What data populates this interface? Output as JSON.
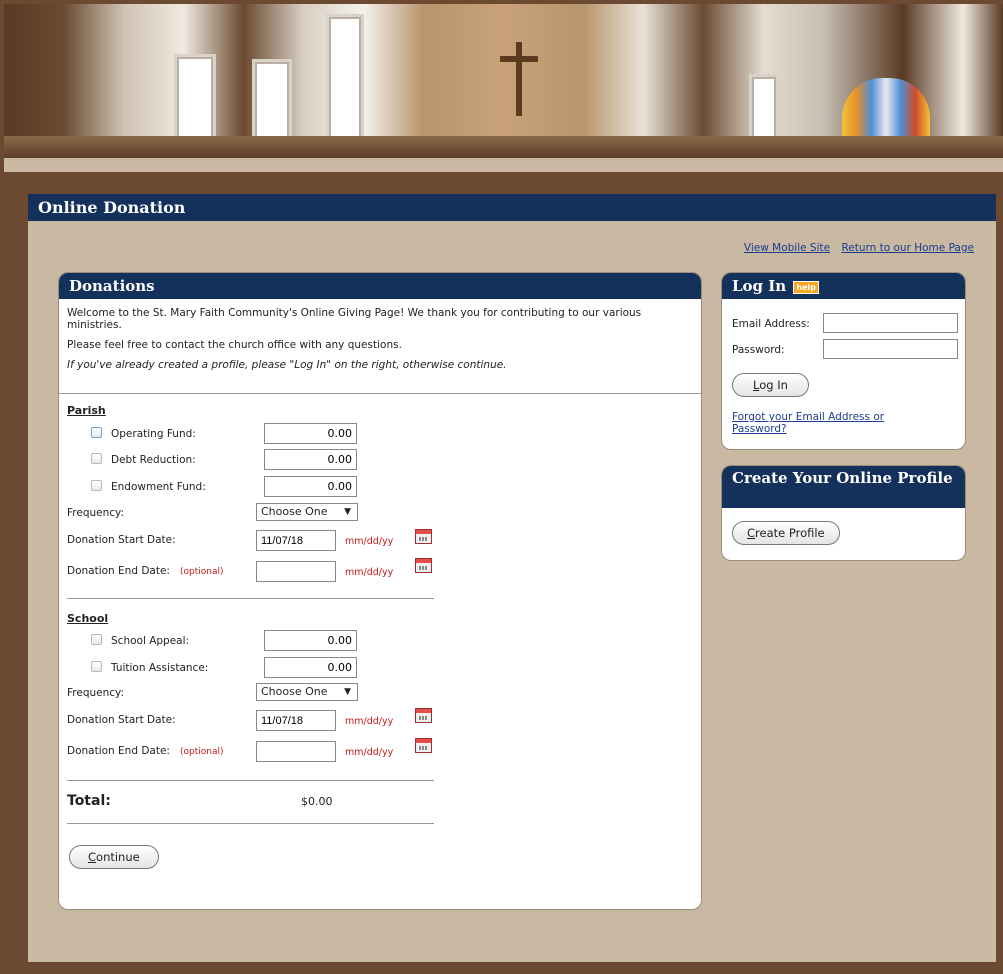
{
  "banner": {
    "description_icon": "church-interior-banner"
  },
  "page": {
    "title": "Online Donation"
  },
  "top_links": {
    "mobile": "View Mobile Site",
    "home": "Return to our Home Page"
  },
  "donations": {
    "header": "Donations",
    "intro": "Welcome to the St. Mary Faith Community's Online Giving Page! We thank you for contributing to our various ministries.",
    "contact": "Please feel free to contact the church office with any questions.",
    "login_hint": "If you've already created a profile, please \"Log In\" on the right, otherwise continue.",
    "parish": {
      "title": "Parish",
      "funds": [
        {
          "label": "Operating Fund:",
          "amount": "0.00"
        },
        {
          "label": "Debt Reduction:",
          "amount": "0.00"
        },
        {
          "label": "Endowment Fund:",
          "amount": "0.00"
        }
      ],
      "frequency_label": "Frequency:",
      "frequency_value": "Choose One",
      "start_label": "Donation Start Date:",
      "start_value": "11/07/18",
      "end_label": "Donation End Date:",
      "end_value": "",
      "optional": "(optional)",
      "date_format": "mm/dd/yy"
    },
    "school": {
      "title": "School",
      "funds": [
        {
          "label": "School Appeal:",
          "amount": "0.00"
        },
        {
          "label": "Tuition Assistance:",
          "amount": "0.00"
        }
      ],
      "frequency_label": "Frequency:",
      "frequency_value": "Choose One",
      "start_label": "Donation Start Date:",
      "start_value": "11/07/18",
      "end_label": "Donation End Date:",
      "end_value": "",
      "optional": "(optional)",
      "date_format": "mm/dd/yy"
    },
    "total_label": "Total:",
    "total_value": "$0.00",
    "continue_rest": "ontinue",
    "continue_first": "C"
  },
  "login": {
    "header": "Log In",
    "help": "help",
    "email_label": "Email Address:",
    "email_value": "",
    "password_label": "Password:",
    "password_value": "",
    "button_first": "L",
    "button_rest": "og In",
    "forgot": "Forgot your Email Address or Password?"
  },
  "create_profile": {
    "header": "Create Your Online Profile",
    "button_first": "C",
    "button_rest": "reate Profile"
  },
  "colors": {
    "header_blue": "#14315c",
    "panel_tan": "#c9b9a2",
    "page_brown": "#6b4a31",
    "accent_red": "#c21b1b"
  }
}
